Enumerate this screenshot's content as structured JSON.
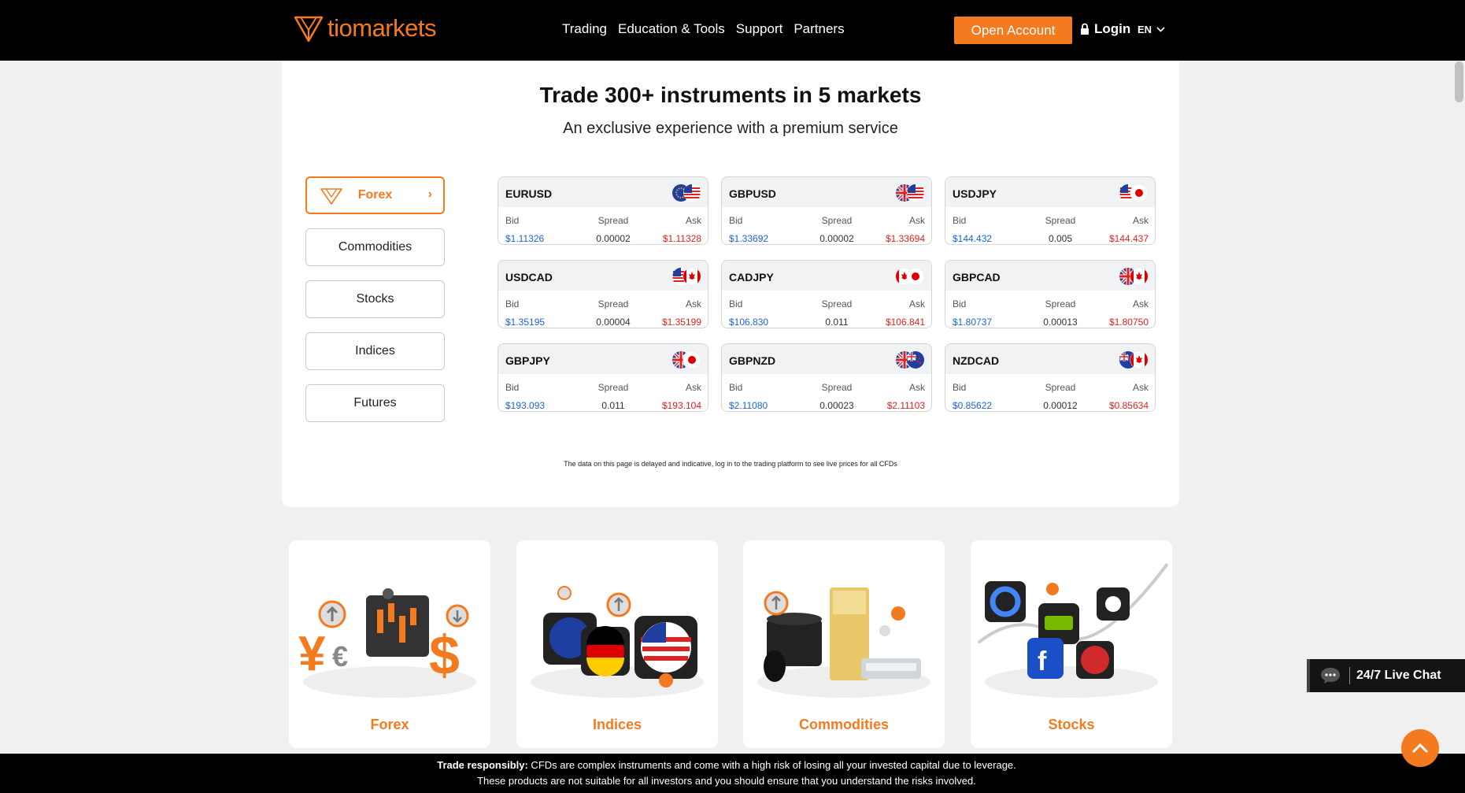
{
  "brand": {
    "name": "tiomarkets",
    "accent": "#f37a1f"
  },
  "nav": {
    "links": [
      "Trading",
      "Education & Tools",
      "Support",
      "Partners"
    ],
    "open_account": "Open Account",
    "login": "Login",
    "language": "EN"
  },
  "hero": {
    "title": "Trade 300+ instruments in 5 markets",
    "subtitle": "An exclusive experience with a premium service"
  },
  "market_tabs": [
    "Forex",
    "Commodities",
    "Stocks",
    "Indices",
    "Futures"
  ],
  "active_tab": "Forex",
  "column_labels": {
    "bid": "Bid",
    "spread": "Spread",
    "ask": "Ask"
  },
  "pairs": [
    {
      "symbol": "EURUSD",
      "bid": "$1.11326",
      "spread": "0.00002",
      "ask": "$1.11328",
      "flags": [
        "eu-flag-icon",
        "us-flag-icon"
      ]
    },
    {
      "symbol": "GBPUSD",
      "bid": "$1.33692",
      "spread": "0.00002",
      "ask": "$1.33694",
      "flags": [
        "uk-flag-icon",
        "us-flag-icon"
      ]
    },
    {
      "symbol": "USDJPY",
      "bid": "$144.432",
      "spread": "0.005",
      "ask": "$144.437",
      "flags": [
        "us-flag-icon",
        "jp-flag-icon"
      ]
    },
    {
      "symbol": "USDCAD",
      "bid": "$1.35195",
      "spread": "0.00004",
      "ask": "$1.35199",
      "flags": [
        "us-flag-icon",
        "ca-flag-icon"
      ]
    },
    {
      "symbol": "CADJPY",
      "bid": "$106.830",
      "spread": "0.011",
      "ask": "$106.841",
      "flags": [
        "ca-flag-icon",
        "jp-flag-icon"
      ]
    },
    {
      "symbol": "GBPCAD",
      "bid": "$1.80737",
      "spread": "0.00013",
      "ask": "$1.80750",
      "flags": [
        "uk-flag-icon",
        "ca-flag-icon"
      ]
    },
    {
      "symbol": "GBPJPY",
      "bid": "$193.093",
      "spread": "0.011",
      "ask": "$193.104",
      "flags": [
        "uk-flag-icon",
        "jp-flag-icon"
      ]
    },
    {
      "symbol": "GBPNZD",
      "bid": "$2.11080",
      "spread": "0.00023",
      "ask": "$2.11103",
      "flags": [
        "uk-flag-icon",
        "nz-flag-icon"
      ]
    },
    {
      "symbol": "NZDCAD",
      "bid": "$0.85622",
      "spread": "0.00012",
      "ask": "$0.85634",
      "flags": [
        "nz-flag-icon",
        "ca-flag-icon"
      ]
    }
  ],
  "disclaimer": "The data on this page is delayed and indicative, log in to the trading platform to see live prices for all CFDs",
  "tiles": [
    "Forex",
    "Indices",
    "Commodities",
    "Stocks"
  ],
  "live_chat": "24/7 Live Chat",
  "risk": {
    "bold": "Trade responsibly:",
    "line1": " CFDs are complex instruments and come with a high risk of losing all your invested capital due to leverage.",
    "line2": "These products are not suitable for all investors and you should ensure that you understand the risks involved."
  }
}
